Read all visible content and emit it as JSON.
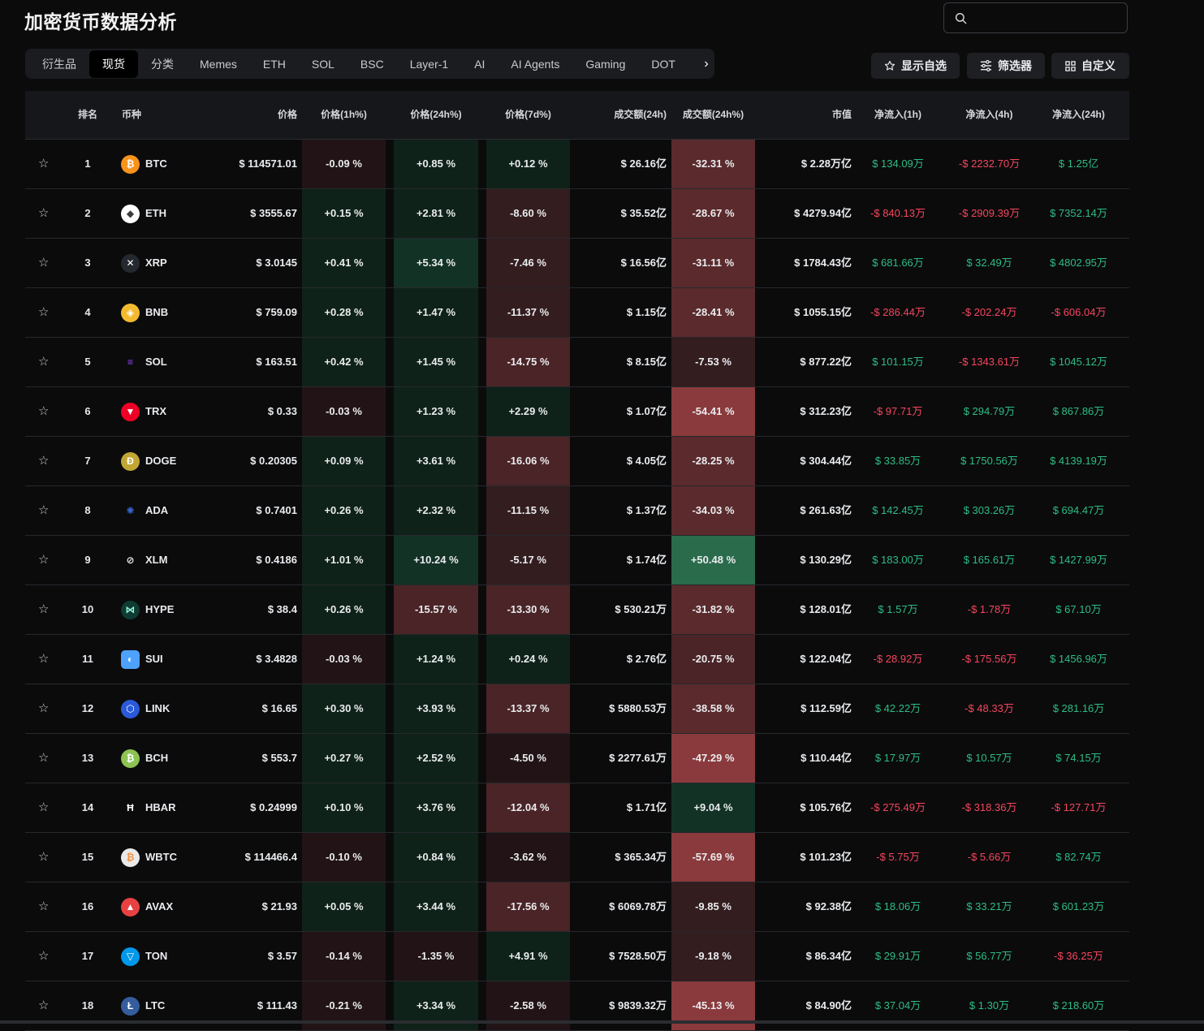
{
  "page_title": "加密货币数据分析",
  "search": {
    "placeholder": ""
  },
  "tabs": [
    "衍生品",
    "现货",
    "分类",
    "Memes",
    "ETH",
    "SOL",
    "BSC",
    "Layer-1",
    "AI",
    "AI Agents",
    "Gaming",
    "DOT"
  ],
  "active_tab": "现货",
  "toolbar": {
    "watchlist_label": "显示自选",
    "filter_label": "筛选器",
    "customize_label": "自定义"
  },
  "columns": [
    "排名",
    "币种",
    "价格",
    "价格(1h%)",
    "价格(24h%)",
    "价格(7d%)",
    "成交额(24h)",
    "成交额(24h%)",
    "市值",
    "净流入(1h)",
    "净流入(4h)",
    "净流入(24h)"
  ],
  "colors": {
    "positive": "#2ebd85",
    "negative": "#f6465d",
    "background": "#0b0b0c"
  },
  "rows": [
    {
      "rank": "1",
      "symbol": "BTC",
      "icon": "bitcoin-icon",
      "price": "$ 114571.01",
      "p1h": "-0.09 %",
      "p24h": "+0.85 %",
      "p7d": "+0.12 %",
      "vol": "$ 26.16亿",
      "vchg": "-32.31 %",
      "mcap": "$ 2.28万亿",
      "f1h": "$ 134.09万",
      "f4h": "-$ 2232.70万",
      "f24h": "$ 1.25亿"
    },
    {
      "rank": "2",
      "symbol": "ETH",
      "icon": "ethereum-icon",
      "price": "$ 3555.67",
      "p1h": "+0.15 %",
      "p24h": "+2.81 %",
      "p7d": "-8.60 %",
      "vol": "$ 35.52亿",
      "vchg": "-28.67 %",
      "mcap": "$ 4279.94亿",
      "f1h": "-$ 840.13万",
      "f4h": "-$ 2909.39万",
      "f24h": "$ 7352.14万"
    },
    {
      "rank": "3",
      "symbol": "XRP",
      "icon": "xrp-icon",
      "price": "$ 3.0145",
      "p1h": "+0.41 %",
      "p24h": "+5.34 %",
      "p7d": "-7.46 %",
      "vol": "$ 16.56亿",
      "vchg": "-31.11 %",
      "mcap": "$ 1784.43亿",
      "f1h": "$ 681.66万",
      "f4h": "$ 32.49万",
      "f24h": "$ 4802.95万"
    },
    {
      "rank": "4",
      "symbol": "BNB",
      "icon": "bnb-icon",
      "price": "$ 759.09",
      "p1h": "+0.28 %",
      "p24h": "+1.47 %",
      "p7d": "-11.37 %",
      "vol": "$ 1.15亿",
      "vchg": "-28.41 %",
      "mcap": "$ 1055.15亿",
      "f1h": "-$ 286.44万",
      "f4h": "-$ 202.24万",
      "f24h": "-$ 606.04万"
    },
    {
      "rank": "5",
      "symbol": "SOL",
      "icon": "solana-icon",
      "price": "$ 163.51",
      "p1h": "+0.42 %",
      "p24h": "+1.45 %",
      "p7d": "-14.75 %",
      "vol": "$ 8.15亿",
      "vchg": "-7.53 %",
      "mcap": "$ 877.22亿",
      "f1h": "$ 101.15万",
      "f4h": "-$ 1343.61万",
      "f24h": "$ 1045.12万"
    },
    {
      "rank": "6",
      "symbol": "TRX",
      "icon": "tron-icon",
      "price": "$ 0.33",
      "p1h": "-0.03 %",
      "p24h": "+1.23 %",
      "p7d": "+2.29 %",
      "vol": "$ 1.07亿",
      "vchg": "-54.41 %",
      "mcap": "$ 312.23亿",
      "f1h": "-$ 97.71万",
      "f4h": "$ 294.79万",
      "f24h": "$ 867.86万"
    },
    {
      "rank": "7",
      "symbol": "DOGE",
      "icon": "dogecoin-icon",
      "price": "$ 0.20305",
      "p1h": "+0.09 %",
      "p24h": "+3.61 %",
      "p7d": "-16.06 %",
      "vol": "$ 4.05亿",
      "vchg": "-28.25 %",
      "mcap": "$ 304.44亿",
      "f1h": "$ 33.85万",
      "f4h": "$ 1750.56万",
      "f24h": "$ 4139.19万"
    },
    {
      "rank": "8",
      "symbol": "ADA",
      "icon": "cardano-icon",
      "price": "$ 0.7401",
      "p1h": "+0.26 %",
      "p24h": "+2.32 %",
      "p7d": "-11.15 %",
      "vol": "$ 1.37亿",
      "vchg": "-34.03 %",
      "mcap": "$ 261.63亿",
      "f1h": "$ 142.45万",
      "f4h": "$ 303.26万",
      "f24h": "$ 694.47万"
    },
    {
      "rank": "9",
      "symbol": "XLM",
      "icon": "stellar-icon",
      "price": "$ 0.4186",
      "p1h": "+1.01 %",
      "p24h": "+10.24 %",
      "p7d": "-5.17 %",
      "vol": "$ 1.74亿",
      "vchg": "+50.48 %",
      "mcap": "$ 130.29亿",
      "f1h": "$ 183.00万",
      "f4h": "$ 165.61万",
      "f24h": "$ 1427.99万"
    },
    {
      "rank": "10",
      "symbol": "HYPE",
      "icon": "hyperliquid-icon",
      "price": "$ 38.4",
      "p1h": "+0.26 %",
      "p24h": "-15.57 %",
      "p7d": "-13.30 %",
      "vol": "$ 530.21万",
      "vchg": "-31.82 %",
      "mcap": "$ 128.01亿",
      "f1h": "$ 1.57万",
      "f4h": "-$ 1.78万",
      "f24h": "$ 67.10万"
    },
    {
      "rank": "11",
      "symbol": "SUI",
      "icon": "sui-icon",
      "price": "$ 3.4828",
      "p1h": "-0.03 %",
      "p24h": "+1.24 %",
      "p7d": "+0.24 %",
      "vol": "$ 2.76亿",
      "vchg": "-20.75 %",
      "mcap": "$ 122.04亿",
      "f1h": "-$ 28.92万",
      "f4h": "-$ 175.56万",
      "f24h": "$ 1456.96万"
    },
    {
      "rank": "12",
      "symbol": "LINK",
      "icon": "chainlink-icon",
      "price": "$ 16.65",
      "p1h": "+0.30 %",
      "p24h": "+3.93 %",
      "p7d": "-13.37 %",
      "vol": "$ 5880.53万",
      "vchg": "-38.58 %",
      "mcap": "$ 112.59亿",
      "f1h": "$ 42.22万",
      "f4h": "-$ 48.33万",
      "f24h": "$ 281.16万"
    },
    {
      "rank": "13",
      "symbol": "BCH",
      "icon": "bitcoin-cash-icon",
      "price": "$ 553.7",
      "p1h": "+0.27 %",
      "p24h": "+2.52 %",
      "p7d": "-4.50 %",
      "vol": "$ 2277.61万",
      "vchg": "-47.29 %",
      "mcap": "$ 110.44亿",
      "f1h": "$ 17.97万",
      "f4h": "$ 10.57万",
      "f24h": "$ 74.15万"
    },
    {
      "rank": "14",
      "symbol": "HBAR",
      "icon": "hedera-icon",
      "price": "$ 0.24999",
      "p1h": "+0.10 %",
      "p24h": "+3.76 %",
      "p7d": "-12.04 %",
      "vol": "$ 1.71亿",
      "vchg": "+9.04 %",
      "mcap": "$ 105.76亿",
      "f1h": "-$ 275.49万",
      "f4h": "-$ 318.36万",
      "f24h": "-$ 127.71万"
    },
    {
      "rank": "15",
      "symbol": "WBTC",
      "icon": "wrapped-bitcoin-icon",
      "price": "$ 114466.4",
      "p1h": "-0.10 %",
      "p24h": "+0.84 %",
      "p7d": "-3.62 %",
      "vol": "$ 365.34万",
      "vchg": "-57.69 %",
      "mcap": "$ 101.23亿",
      "f1h": "-$ 5.75万",
      "f4h": "-$ 5.66万",
      "f24h": "$ 82.74万"
    },
    {
      "rank": "16",
      "symbol": "AVAX",
      "icon": "avalanche-icon",
      "price": "$ 21.93",
      "p1h": "+0.05 %",
      "p24h": "+3.44 %",
      "p7d": "-17.56 %",
      "vol": "$ 6069.78万",
      "vchg": "-9.85 %",
      "mcap": "$ 92.38亿",
      "f1h": "$ 18.06万",
      "f4h": "$ 33.21万",
      "f24h": "$ 601.23万"
    },
    {
      "rank": "17",
      "symbol": "TON",
      "icon": "toncoin-icon",
      "price": "$ 3.57",
      "p1h": "-0.14 %",
      "p24h": "-1.35 %",
      "p7d": "+4.91 %",
      "vol": "$ 7528.50万",
      "vchg": "-9.18 %",
      "mcap": "$ 86.34亿",
      "f1h": "$ 29.91万",
      "f4h": "$ 56.77万",
      "f24h": "-$ 36.25万"
    },
    {
      "rank": "18",
      "symbol": "LTC",
      "icon": "litecoin-icon",
      "price": "$ 111.43",
      "p1h": "-0.21 %",
      "p24h": "+3.34 %",
      "p7d": "-2.58 %",
      "vol": "$ 9839.32万",
      "vchg": "-45.13 %",
      "mcap": "$ 84.90亿",
      "f1h": "$ 37.04万",
      "f4h": "$ 1.30万",
      "f24h": "$ 218.60万"
    }
  ]
}
